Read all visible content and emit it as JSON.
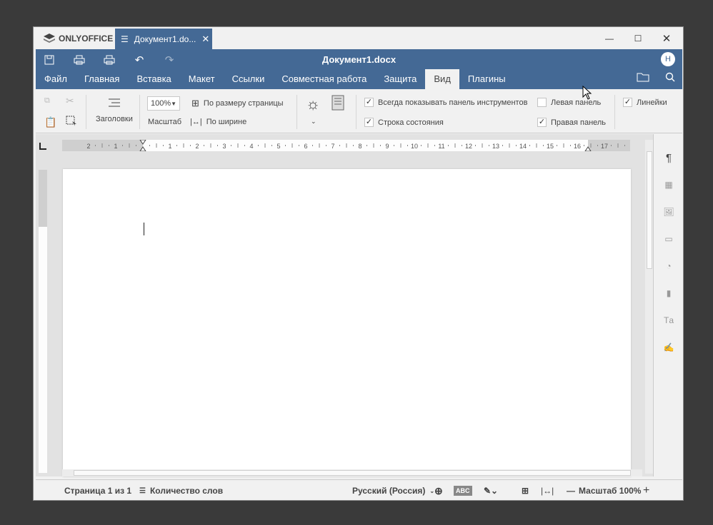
{
  "app": {
    "logo": "ONLYOFFICE",
    "tab_title": "Документ1.do...",
    "doc_title": "Документ1.docx",
    "avatar": "Н"
  },
  "tabs": [
    "Файл",
    "Главная",
    "Вставка",
    "Макет",
    "Ссылки",
    "Совместная работа",
    "Защита",
    "Вид",
    "Плагины"
  ],
  "active_tab": "Вид",
  "toolbar": {
    "headings": "Заголовки",
    "zoom_value": "100%",
    "zoom_label": "Масштаб",
    "fit_page": "По размеру страницы",
    "fit_width": "По ширине",
    "always_toolbar": "Всегда показывать панель инструментов",
    "status_bar": "Строка состояния",
    "left_panel": "Левая панель",
    "right_panel": "Правая панель",
    "rulers": "Линейки"
  },
  "checks": {
    "always_toolbar": true,
    "status_bar": true,
    "left_panel": false,
    "right_panel": true,
    "rulers": true
  },
  "ruler_numbers": [
    "2",
    "1",
    "1",
    "2",
    "3",
    "4",
    "5",
    "6",
    "7",
    "8",
    "9",
    "10",
    "11",
    "12",
    "13",
    "14",
    "15",
    "16",
    "17"
  ],
  "status": {
    "page": "Страница 1 из 1",
    "word_count": "Количество слов",
    "language": "Русский (Россия)",
    "zoom": "Масштаб 100%"
  },
  "colors": {
    "header": "#446995",
    "bg": "#f1f1f1"
  }
}
